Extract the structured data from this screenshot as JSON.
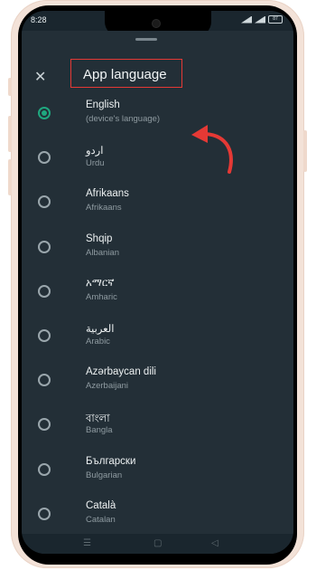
{
  "status": {
    "time": "8:28",
    "battery": "87"
  },
  "header": {
    "title": "App language"
  },
  "languages": [
    {
      "name": "English",
      "sub": "(device's language)",
      "selected": true
    },
    {
      "name": "اردو",
      "sub": "Urdu",
      "selected": false
    },
    {
      "name": "Afrikaans",
      "sub": "Afrikaans",
      "selected": false
    },
    {
      "name": "Shqip",
      "sub": "Albanian",
      "selected": false
    },
    {
      "name": "አማርኛ",
      "sub": "Amharic",
      "selected": false
    },
    {
      "name": "العربية",
      "sub": "Arabic",
      "selected": false
    },
    {
      "name": "Azərbaycan dili",
      "sub": "Azerbaijani",
      "selected": false
    },
    {
      "name": "বাংলা",
      "sub": "Bangla",
      "selected": false
    },
    {
      "name": "Български",
      "sub": "Bulgarian",
      "selected": false
    },
    {
      "name": "Català",
      "sub": "Catalan",
      "selected": false
    }
  ],
  "icons": {
    "close": "close-icon",
    "arrow": "red-curved-arrow-icon"
  },
  "colors": {
    "accent": "#1fa77f",
    "highlight": "#e53935",
    "background": "#232f37"
  }
}
